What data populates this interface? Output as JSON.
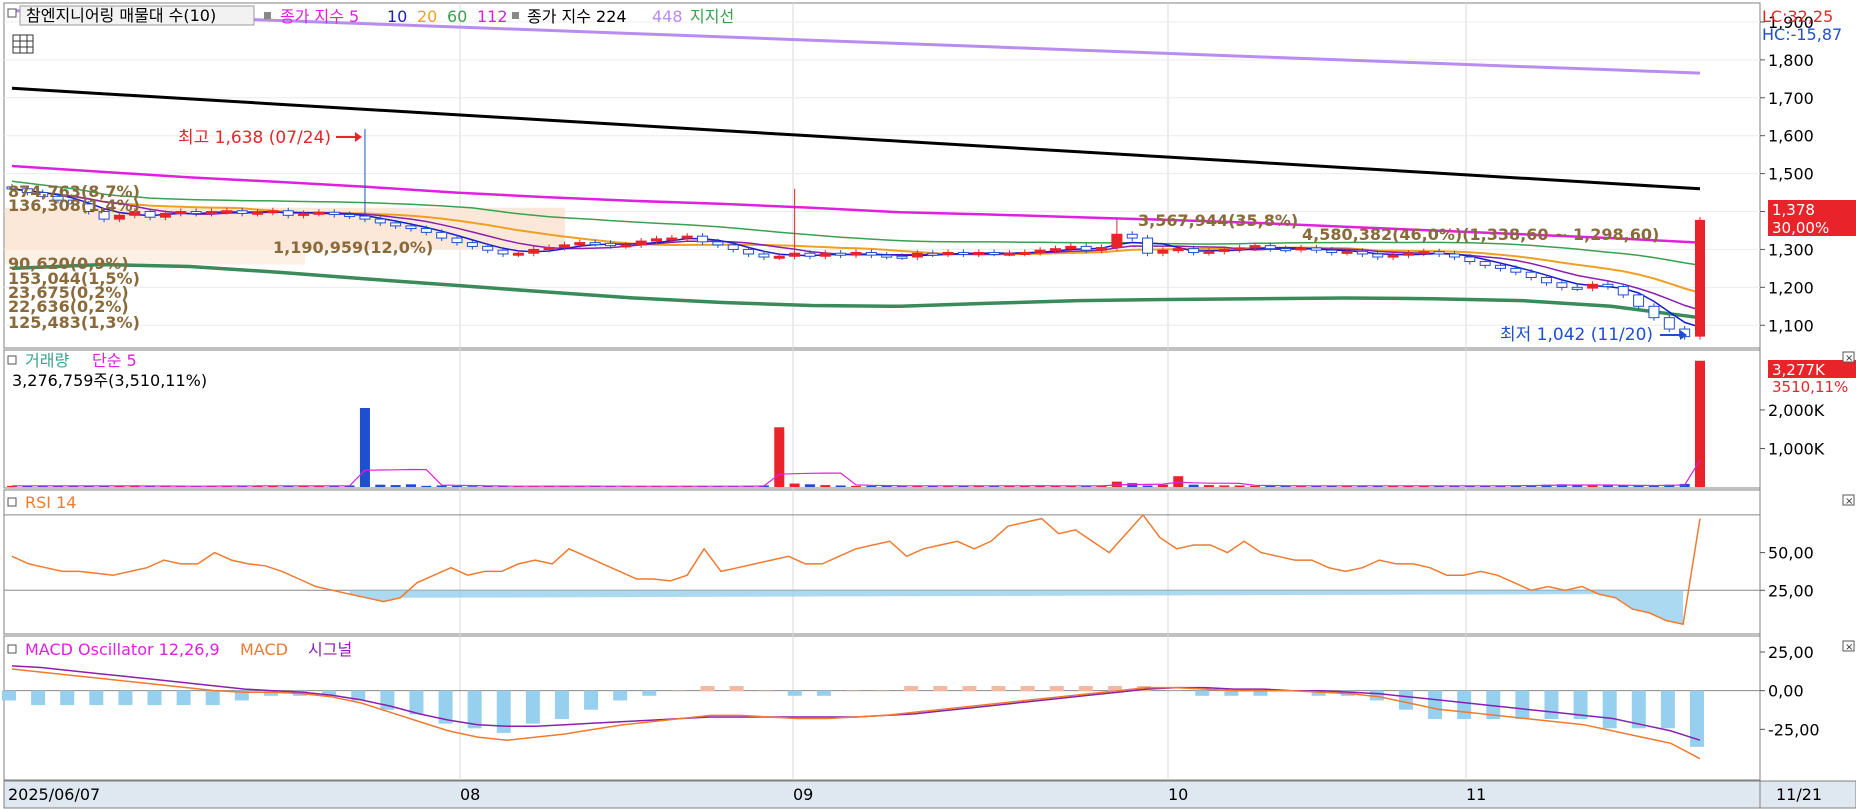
{
  "colors": {
    "up": "#e8242a",
    "down": "#1f4fcf",
    "ma5": "#1a1ad0",
    "ma10": "#8a1fb0",
    "ma20": "#f0a020",
    "ma60": "#3aa050",
    "ma112": "#e020e0",
    "ma224": "#000000",
    "ma448": "#b98cf0",
    "support": "#3a8a5a",
    "rsi": "#f07a30",
    "macd": "#f07a30",
    "signal": "#8a1fb0",
    "osc_pos": "#f4b8a0",
    "osc_neg": "#96d0ee",
    "vol_ma": "#e020e0",
    "bands": "#c8a070"
  },
  "price_panel": {
    "legend": {
      "stock": "참엔지니어링 매물대 수(10)",
      "ma_label": "종가 지수 5",
      "ma_values": [
        "10",
        "20",
        "60",
        "112"
      ],
      "ma2_label": "종가 지수 224",
      "ma2_value": "448",
      "support_label": "지지선"
    },
    "lc": "LC:32,25",
    "hc": "HC:-15,87",
    "last_price_tag": "1,378",
    "last_pct_tag": "30,00%",
    "high_note": "최고 1,638 (07/24)",
    "low_note": "최저 1,042 (11/20)",
    "band_labels": [
      "874,763(8,7%)",
      "136,308(1,4%)",
      "1,190,959(12,0%)",
      "90,620(0,9%)",
      "153,044(1,5%)",
      "23,675(0,2%)",
      "22,636(0,2%)",
      "125,483(1,3%)"
    ],
    "band_labels_right": [
      "3,567,944(35,8%)",
      "4,580,382(46,0%)(1,338,60 ~ 1,298,60)"
    ],
    "ticks": [
      "1,900",
      "1,800",
      "1,700",
      "1,600",
      "1,500",
      "1,400",
      "1,300",
      "1,200",
      "1,100"
    ]
  },
  "volume_panel": {
    "legend": "거래량",
    "legend2": "단순 5",
    "value": "3,276,759주(3,510,11%)",
    "tag": "3,277K",
    "tag2": "3510,11%",
    "ticks": [
      "2,000K",
      "1,000K"
    ]
  },
  "rsi_panel": {
    "legend": "RSI 14",
    "ticks": [
      "50,00",
      "25,00"
    ]
  },
  "macd_panel": {
    "legend1": "MACD Oscillator 12,26,9",
    "legend2": "MACD",
    "legend3": "시그널",
    "ticks": [
      "25,00",
      "0,00",
      "-25,00"
    ]
  },
  "x_axis": {
    "labels": [
      "2025/06/07",
      "08",
      "09",
      "10",
      "11"
    ],
    "right": "11/21"
  },
  "chart_data": {
    "type": "candlestick",
    "start_date": "2025/06/07",
    "end_date": "11/21",
    "note_high": {
      "date": "07/24",
      "value": 1638
    },
    "note_low": {
      "date": "11/20",
      "value": 1042
    },
    "y_range": [
      1040,
      1950
    ],
    "close": [
      1460,
      1450,
      1440,
      1430,
      1420,
      1400,
      1380,
      1390,
      1400,
      1385,
      1395,
      1400,
      1395,
      1400,
      1402,
      1395,
      1398,
      1402,
      1390,
      1395,
      1398,
      1392,
      1388,
      1380,
      1370,
      1362,
      1355,
      1345,
      1330,
      1318,
      1308,
      1298,
      1288,
      1290,
      1300,
      1305,
      1312,
      1318,
      1316,
      1310,
      1312,
      1322,
      1328,
      1330,
      1335,
      1320,
      1312,
      1300,
      1288,
      1280,
      1282,
      1290,
      1282,
      1290,
      1285,
      1292,
      1285,
      1282,
      1280,
      1290,
      1288,
      1292,
      1288,
      1292,
      1290,
      1290,
      1292,
      1298,
      1302,
      1308,
      1298,
      1305,
      1340,
      1330,
      1290,
      1298,
      1302,
      1292,
      1295,
      1300,
      1304,
      1310,
      1302,
      1300,
      1304,
      1298,
      1292,
      1295,
      1288,
      1280,
      1285,
      1290,
      1294,
      1288,
      1280,
      1268,
      1258,
      1250,
      1240,
      1226,
      1212,
      1200,
      1198,
      1208,
      1202,
      1180,
      1150,
      1120,
      1090,
      1070,
      1378
    ],
    "volume_k": [
      30,
      30,
      30,
      25,
      30,
      25,
      30,
      30,
      25,
      20,
      25,
      20,
      20,
      30,
      30,
      30,
      30,
      30,
      20,
      30,
      30,
      30,
      40,
      2050,
      60,
      50,
      70,
      30,
      40,
      30,
      20,
      20,
      20,
      20,
      30,
      30,
      20,
      20,
      20,
      20,
      20,
      20,
      20,
      20,
      20,
      20,
      20,
      20,
      30,
      40,
      1550,
      90,
      70,
      50,
      40,
      30,
      30,
      30,
      30,
      30,
      30,
      30,
      30,
      40,
      30,
      30,
      30,
      40,
      30,
      30,
      30,
      30,
      140,
      100,
      40,
      60,
      280,
      60,
      50,
      40,
      40,
      30,
      30,
      30,
      30,
      30,
      30,
      30,
      30,
      30,
      30,
      30,
      30,
      30,
      30,
      30,
      30,
      40,
      40,
      40,
      60,
      70,
      50,
      40,
      40,
      40,
      40,
      40,
      60,
      80,
      3277
    ],
    "rsi14": [
      48,
      44,
      42,
      40,
      40,
      39,
      38,
      40,
      42,
      46,
      44,
      44,
      50,
      46,
      44,
      43,
      40,
      36,
      32,
      30,
      28,
      26,
      24,
      26,
      34,
      38,
      42,
      38,
      40,
      40,
      44,
      46,
      44,
      52,
      48,
      44,
      40,
      36,
      36,
      35,
      38,
      52,
      40,
      42,
      44,
      46,
      48,
      44,
      44,
      48,
      52,
      54,
      56,
      48,
      52,
      54,
      56,
      52,
      56,
      64,
      66,
      68,
      60,
      62,
      56,
      50,
      60,
      70,
      58,
      52,
      54,
      54,
      50,
      56,
      50,
      48,
      46,
      46,
      42,
      40,
      42,
      46,
      44,
      44,
      42,
      38,
      38,
      40,
      38,
      34,
      30,
      32,
      30,
      32,
      28,
      26,
      20,
      18,
      14,
      12,
      68
    ],
    "macd": [
      14,
      12,
      10,
      8,
      6,
      4,
      2,
      0,
      -1,
      -1,
      -2,
      -4,
      -8,
      -14,
      -20,
      -26,
      -30,
      -32,
      -30,
      -28,
      -25,
      -22,
      -20,
      -18,
      -16,
      -16,
      -17,
      -18,
      -18,
      -17,
      -16,
      -14,
      -12,
      -10,
      -8,
      -6,
      -4,
      -2,
      0,
      2,
      2,
      1,
      0,
      0,
      0,
      -1,
      -2,
      -4,
      -8,
      -12,
      -14,
      -16,
      -18,
      -20,
      -22,
      -26,
      -30,
      -34,
      -44
    ],
    "signal": [
      16,
      15,
      13,
      11,
      9,
      7,
      5,
      3,
      1,
      0,
      -1,
      -3,
      -6,
      -10,
      -15,
      -19,
      -22,
      -23,
      -23,
      -22,
      -21,
      -20,
      -19,
      -18,
      -17,
      -17,
      -17,
      -17,
      -17,
      -17,
      -16,
      -15,
      -13,
      -11,
      -9,
      -7,
      -5,
      -3,
      -1,
      1,
      2,
      2,
      1,
      1,
      0,
      0,
      -1,
      -2,
      -4,
      -6,
      -8,
      -10,
      -12,
      -14,
      -16,
      -18,
      -22,
      -26,
      -32
    ]
  }
}
